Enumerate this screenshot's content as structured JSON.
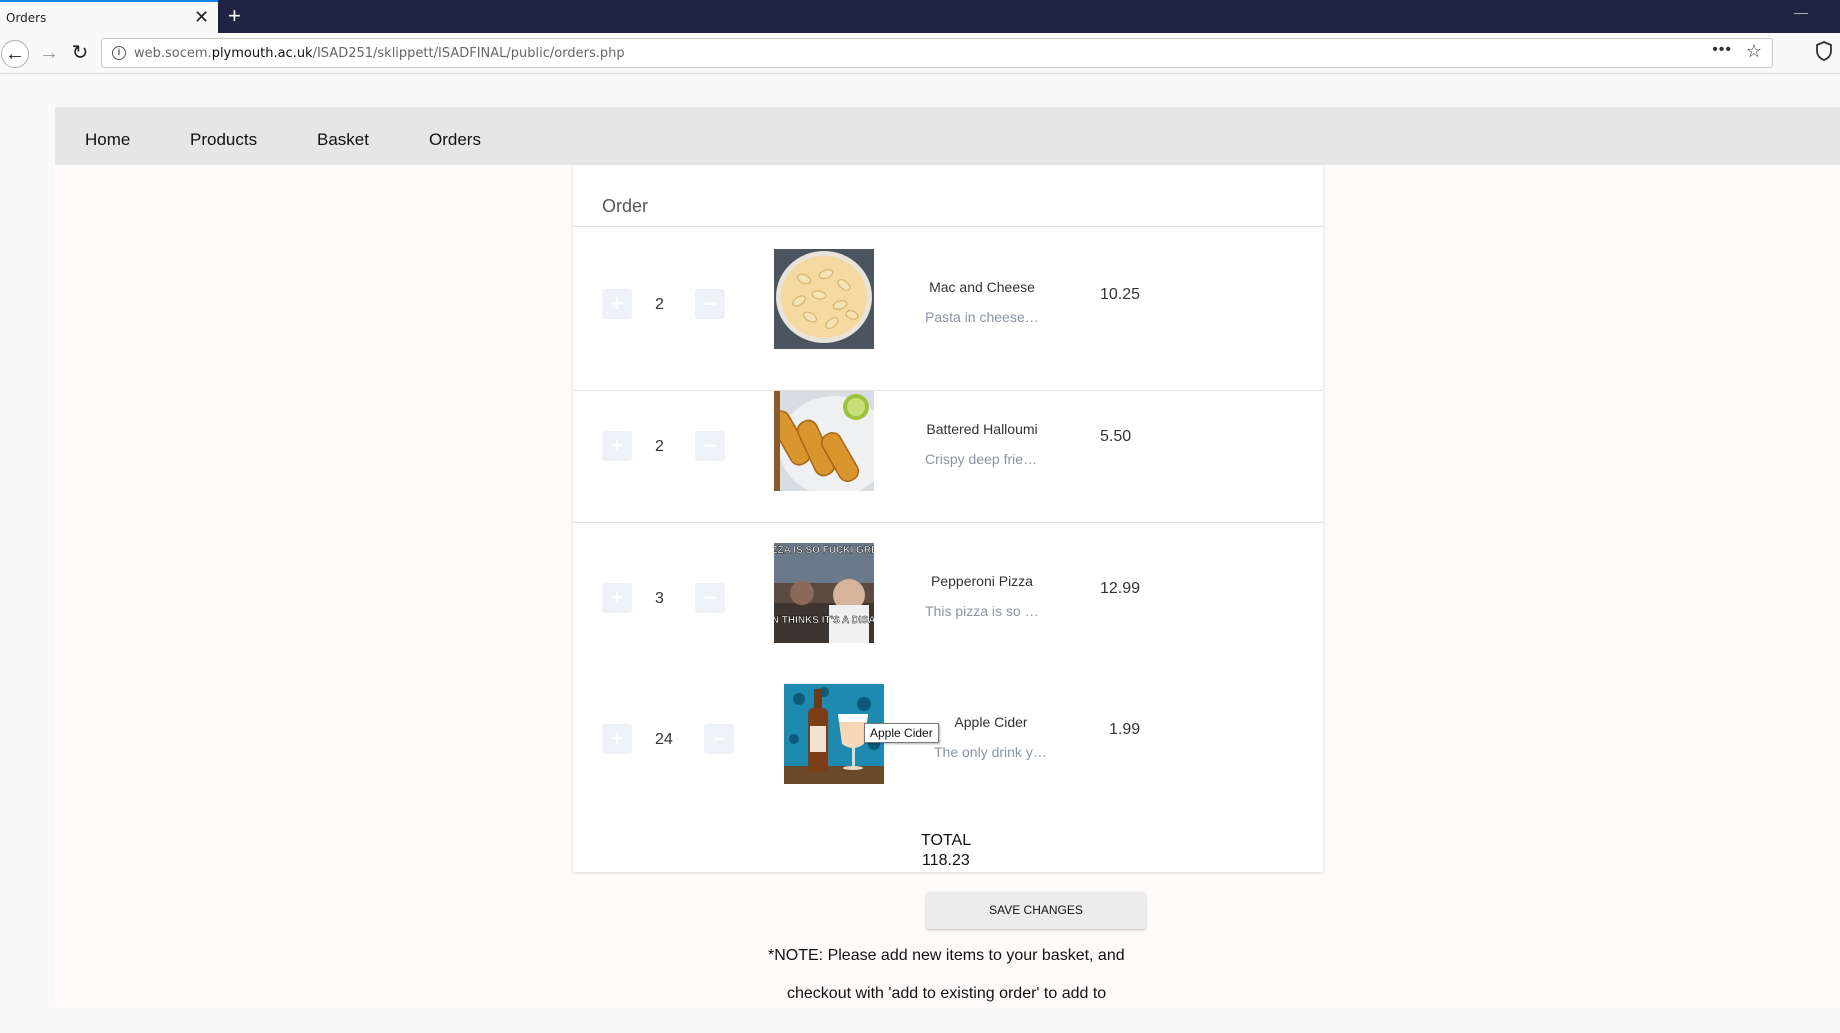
{
  "browser": {
    "tab_title": "Orders",
    "tab_close": "✕",
    "new_tab": "+",
    "url_prefix": "web.socem.",
    "url_domain": "plymouth.ac.uk",
    "url_path": "/ISAD251/sklippett/ISADFINAL/public/orders.php",
    "url_more": "•••",
    "back_glyph": "←",
    "forward_glyph": "→",
    "reload_glyph": "↻",
    "info_glyph": "i",
    "star_glyph": "☆",
    "minimize_glyph": "—"
  },
  "site_nav": {
    "home": "Home",
    "products": "Products",
    "basket": "Basket",
    "orders": "Orders"
  },
  "order": {
    "title": "Order",
    "plus_glyph": "+",
    "minus_glyph": "−",
    "items": [
      {
        "qty": "2",
        "name": "Mac and Cheese",
        "desc": "Pasta in cheese sauce",
        "price": "10.25"
      },
      {
        "qty": "2",
        "name": "Battered Halloumi",
        "desc": "Crispy deep fried halloumi",
        "price": "5.50"
      },
      {
        "qty": "3",
        "name": "Pepperoni Pizza",
        "desc": "This pizza is so greasy",
        "price": "12.99",
        "image_text_top": "IS PIZZA IS SO FUCKI GREASY",
        "image_text_bottom": "P EVEN THINKS IT'S A DISASTER!"
      },
      {
        "qty": "24",
        "name": "Apple Cider",
        "desc": "The only drink you need",
        "price": "1.99"
      }
    ],
    "tooltip": "Apple Cider",
    "total_label": "TOTAL",
    "total_value": "118.23"
  },
  "save_button": "SAVE CHANGES",
  "note_line1": "*NOTE: Please add new items to your basket, and",
  "note_line2": "checkout with 'add to existing order' to add to"
}
